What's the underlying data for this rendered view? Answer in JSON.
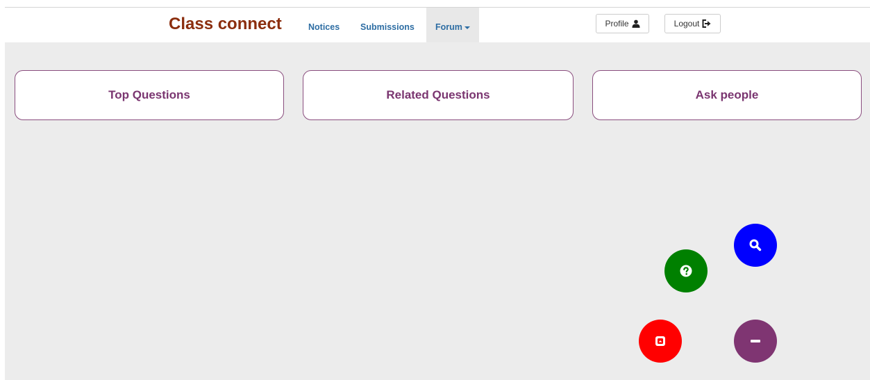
{
  "header": {
    "brand": "Class connect",
    "nav": {
      "notices": "Notices",
      "submissions": "Submissions",
      "forum": "Forum"
    },
    "profile_label": "Profile",
    "logout_label": "Logout"
  },
  "cards": {
    "top_questions": "Top Questions",
    "related_questions": "Related Questions",
    "ask_people": "Ask people"
  },
  "fabs": [
    {
      "icon": "search-icon",
      "color": "#0000ff"
    },
    {
      "icon": "question-icon",
      "color": "#008000"
    },
    {
      "icon": "collapse-icon",
      "color": "#ff0000"
    },
    {
      "icon": "minus-icon",
      "color": "#7f3572"
    }
  ],
  "colors": {
    "brand": "#8b2e0e",
    "nav_link": "#2d6da3",
    "card_text": "#7a3570",
    "card_border": "#8a4d7e",
    "background": "#ececec"
  }
}
